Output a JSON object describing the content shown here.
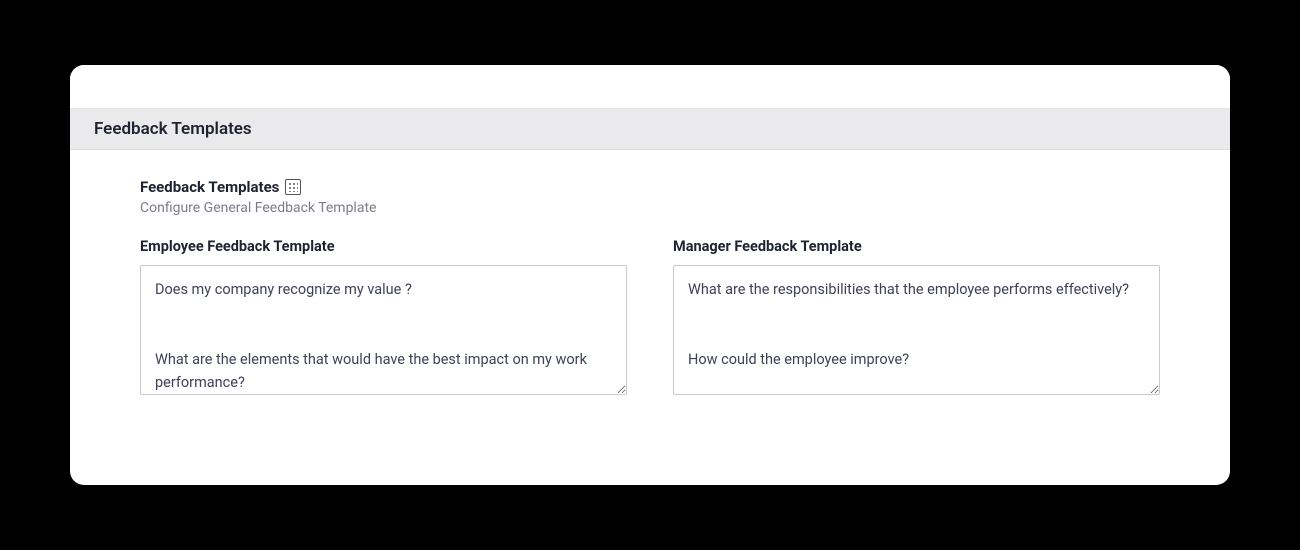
{
  "header": {
    "title": "Feedback Templates"
  },
  "page": {
    "heading": "Feedback Templates",
    "subtitle": "Configure General Feedback Template"
  },
  "templates": {
    "employee": {
      "label": "Employee Feedback Template",
      "value": "Does my company recognize my value ?\n\n\nWhat are the elements that would have the best impact on my work performance?"
    },
    "manager": {
      "label": "Manager Feedback Template",
      "value": "What are the responsibilities that the employee performs effectively?\n\n\nHow could the employee improve?"
    }
  }
}
